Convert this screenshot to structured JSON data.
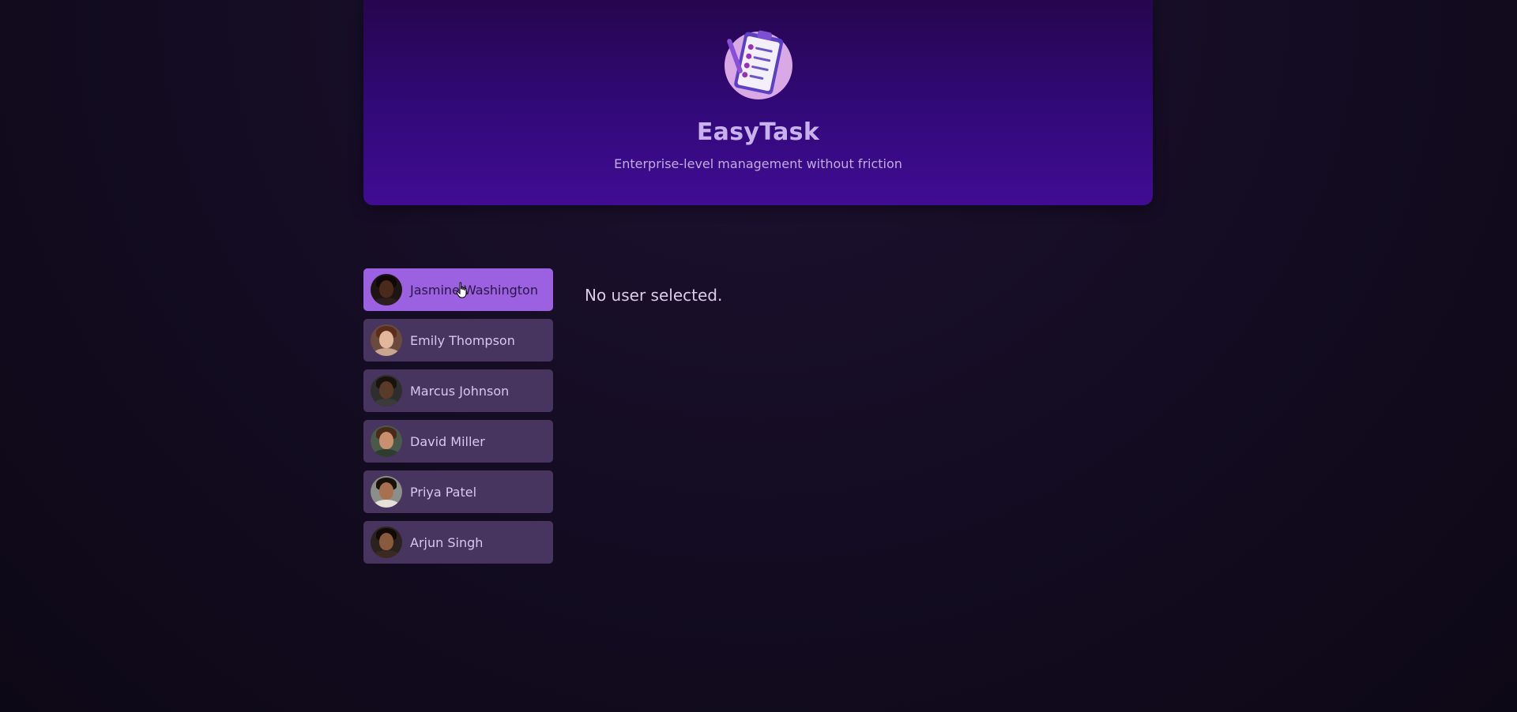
{
  "header": {
    "logo_icon": "clipboard-checklist-icon",
    "title": "EasyTask",
    "subtitle": "Enterprise-level management without friction"
  },
  "users": [
    {
      "name": "Jasmine Washington",
      "active": true,
      "avatar_colors": {
        "bg": "#1e1412",
        "skin": "#4a2a1a",
        "hair": "#0e0806",
        "shirt": "#2a1e1e"
      }
    },
    {
      "name": "Emily Thompson",
      "active": false,
      "avatar_colors": {
        "bg": "#6b4a3e",
        "skin": "#e3b79a",
        "hair": "#5a2e1c",
        "shirt": "#c9a58f"
      }
    },
    {
      "name": "Marcus Johnson",
      "active": false,
      "avatar_colors": {
        "bg": "#2e2e2e",
        "skin": "#5a3b28",
        "hair": "#1a120c",
        "shirt": "#3b3b3b"
      }
    },
    {
      "name": "David Miller",
      "active": false,
      "avatar_colors": {
        "bg": "#4a5a4a",
        "skin": "#c98f6e",
        "hair": "#4a2a18",
        "shirt": "#2f3d2f"
      }
    },
    {
      "name": "Priya Patel",
      "active": false,
      "avatar_colors": {
        "bg": "#8a8f8a",
        "skin": "#a8704e",
        "hair": "#1a100a",
        "shirt": "#e6e0d8"
      }
    },
    {
      "name": "Arjun Singh",
      "active": false,
      "avatar_colors": {
        "bg": "#2b2220",
        "skin": "#8a5a3c",
        "hair": "#120a06",
        "shirt": "#3a2a22"
      }
    }
  ],
  "main": {
    "empty_message": "No user selected."
  },
  "colors": {
    "accent": "#9c61e0",
    "item_bg": "#47345f",
    "header_top": "#26064e",
    "header_bottom": "#400c93"
  }
}
